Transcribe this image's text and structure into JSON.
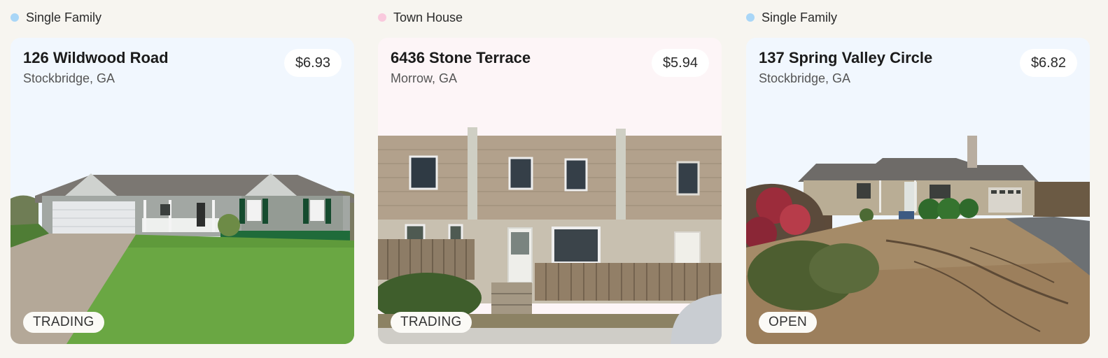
{
  "listings": [
    {
      "category": "Single Family",
      "category_color": "#a9d6f7",
      "card_bg": "#f1f7fe",
      "title": "126 Wildwood Road",
      "location": "Stockbridge, GA",
      "price": "$6.93",
      "status": "TRADING"
    },
    {
      "category": "Town House",
      "category_color": "#f9c9dd",
      "card_bg": "#fdf5f7",
      "title": "6436 Stone Terrace",
      "location": "Morrow, GA",
      "price": "$5.94",
      "status": "TRADING"
    },
    {
      "category": "Single Family",
      "category_color": "#a9d6f7",
      "card_bg": "#f1f7fe",
      "title": "137 Spring Valley Circle",
      "location": "Stockbridge, GA",
      "price": "$6.82",
      "status": "OPEN"
    }
  ]
}
